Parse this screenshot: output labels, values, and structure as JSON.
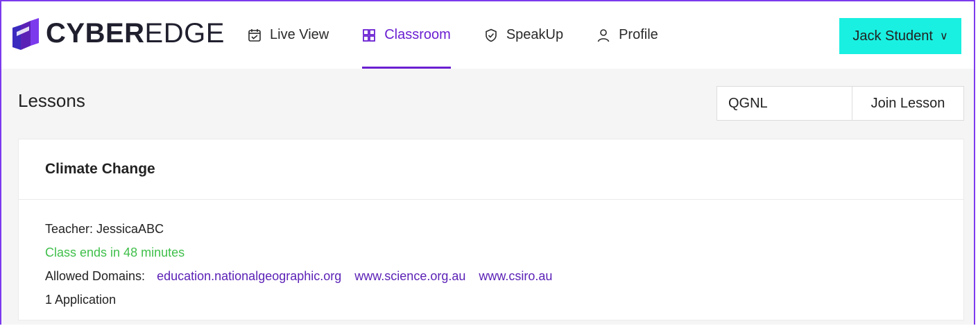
{
  "brand": {
    "bold": "CYBER",
    "light": "EDGE"
  },
  "nav": [
    {
      "label": "Live View",
      "icon": "calendar-icon"
    },
    {
      "label": "Classroom",
      "icon": "grid-icon"
    },
    {
      "label": "SpeakUp",
      "icon": "shield-icon"
    },
    {
      "label": "Profile",
      "icon": "user-icon"
    }
  ],
  "user": {
    "name": "Jack Student",
    "chevron": "∨"
  },
  "lessons": {
    "title": "Lessons",
    "code_value": "QGNL",
    "join_label": "Join Lesson"
  },
  "lesson_card": {
    "title": "Climate Change",
    "teacher": "Teacher:  JessicaABC",
    "status": "Class ends in 48 minutes",
    "allowed_label": "Allowed Domains:",
    "domains": [
      "education.nationalgeographic.org",
      "www.science.org.au",
      "www.csiro.au"
    ],
    "applications": "1 Application"
  },
  "colors": {
    "accent": "#6a1fd1",
    "user_button": "#19f0e1",
    "status_green": "#3fbf4a",
    "frame_border": "#7c3aed"
  }
}
